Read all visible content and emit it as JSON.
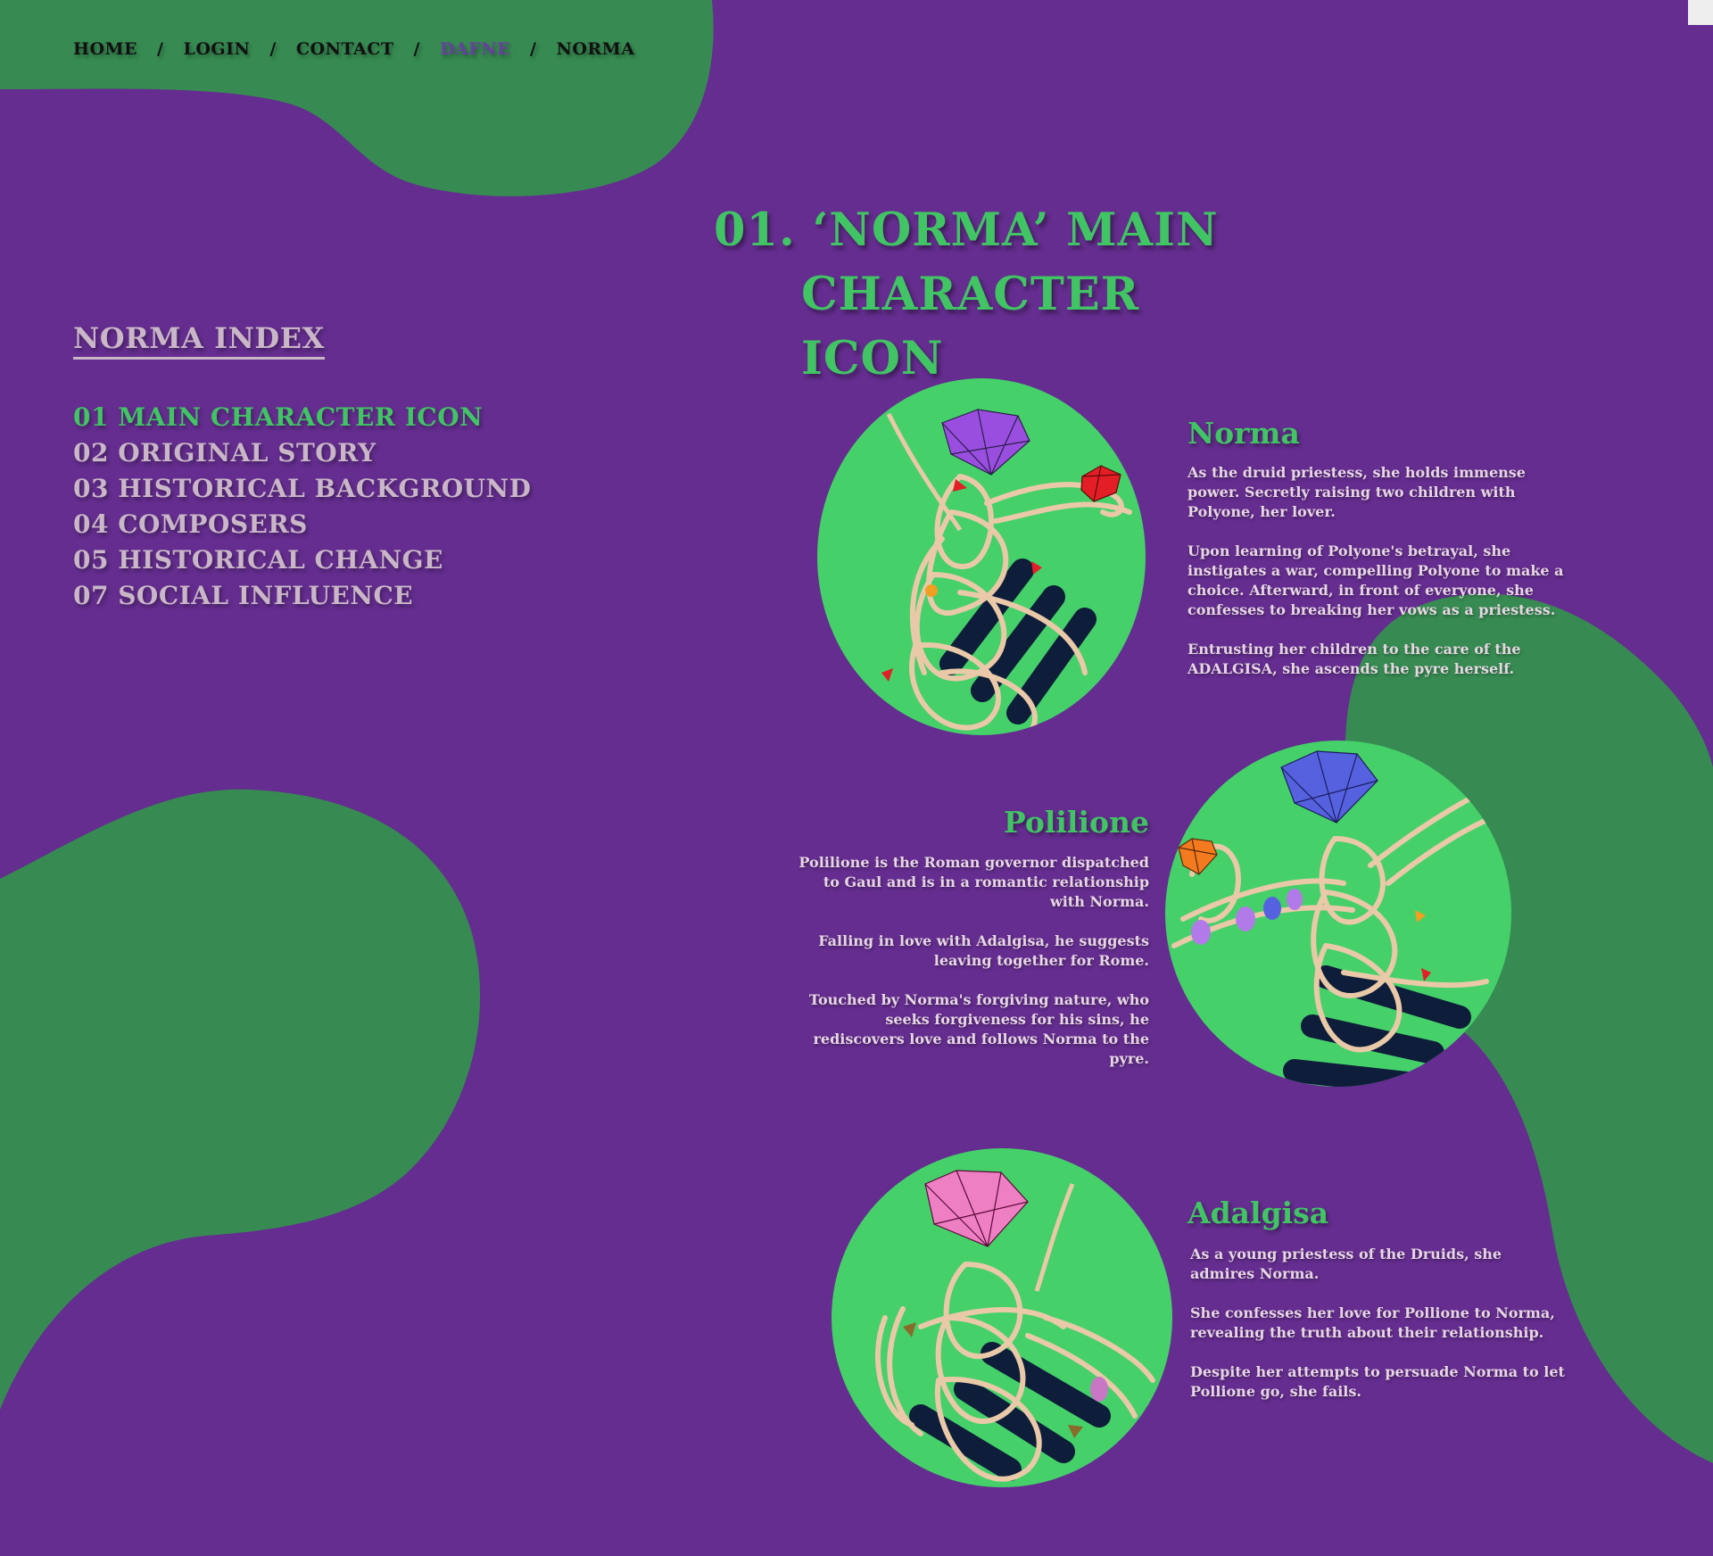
{
  "colors": {
    "background": "#642d8f",
    "blob": "#378b52",
    "accent": "#41c464",
    "muted": "#c9b6c7",
    "nav_active": "#6a3ea0"
  },
  "nav": {
    "items": [
      {
        "label": "HOME"
      },
      {
        "label": "LOGIN"
      },
      {
        "label": "CONTACT"
      },
      {
        "label": "DAFNE",
        "active": true
      },
      {
        "label": "NORMA"
      }
    ],
    "separator": "/"
  },
  "page": {
    "title_line1": "01. ‘NORMA’ MAIN",
    "title_line2": "CHARACTER ICON"
  },
  "index": {
    "title": "NORMA INDEX",
    "items": [
      {
        "label": "01 MAIN CHARACTER ICON",
        "current": true
      },
      {
        "label": "02 ORIGINAL STORY"
      },
      {
        "label": "03 HISTORICAL BACKGROUND"
      },
      {
        "label": "04 COMPOSERS"
      },
      {
        "label": "05 HISTORICAL CHANGE"
      },
      {
        "label": "07 SOCIAL INFLUENCE"
      }
    ]
  },
  "characters": [
    {
      "name": "Norma",
      "gem_color": "#9a4ee0",
      "paragraphs": [
        "As the druid priestess, she holds immense power. Secretly raising two children with Polyone, her lover.",
        "Upon learning of Polyone's betrayal, she instigates a war, compelling Polyone to make a choice. Afterward, in front of everyone, she confesses to breaking her vows as a priestess.",
        "Entrusting her children to the care of the ADALGISA, she ascends the pyre herself."
      ]
    },
    {
      "name": "Polilione",
      "gem_color": "#5661e0",
      "paragraphs": [
        "Polilione is the Roman governor dispatched to Gaul and is in a romantic relationship with Norma.",
        "Falling in love with Adalgisa, he suggests leaving together for Rome.",
        "Touched by Norma's forgiving nature, who seeks forgiveness for his sins, he rediscovers love and follows Norma to the pyre."
      ]
    },
    {
      "name": "Adalgisa",
      "gem_color": "#ee7fc2",
      "paragraphs": [
        "As a young priestess of the Druids, she admires Norma.",
        "She confesses her love for Pollione to Norma, revealing the truth about their relationship.",
        "Despite her attempts to persuade Norma to let Pollione go, she fails."
      ]
    }
  ]
}
